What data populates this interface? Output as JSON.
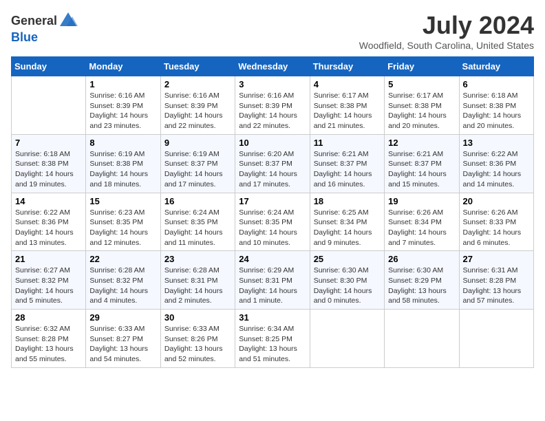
{
  "header": {
    "logo_general": "General",
    "logo_blue": "Blue",
    "month": "July 2024",
    "location": "Woodfield, South Carolina, United States"
  },
  "days_of_week": [
    "Sunday",
    "Monday",
    "Tuesday",
    "Wednesday",
    "Thursday",
    "Friday",
    "Saturday"
  ],
  "weeks": [
    [
      {
        "day": "",
        "empty": true
      },
      {
        "day": "1",
        "sunrise": "Sunrise: 6:16 AM",
        "sunset": "Sunset: 8:39 PM",
        "daylight": "Daylight: 14 hours and 23 minutes."
      },
      {
        "day": "2",
        "sunrise": "Sunrise: 6:16 AM",
        "sunset": "Sunset: 8:39 PM",
        "daylight": "Daylight: 14 hours and 22 minutes."
      },
      {
        "day": "3",
        "sunrise": "Sunrise: 6:16 AM",
        "sunset": "Sunset: 8:39 PM",
        "daylight": "Daylight: 14 hours and 22 minutes."
      },
      {
        "day": "4",
        "sunrise": "Sunrise: 6:17 AM",
        "sunset": "Sunset: 8:38 PM",
        "daylight": "Daylight: 14 hours and 21 minutes."
      },
      {
        "day": "5",
        "sunrise": "Sunrise: 6:17 AM",
        "sunset": "Sunset: 8:38 PM",
        "daylight": "Daylight: 14 hours and 20 minutes."
      },
      {
        "day": "6",
        "sunrise": "Sunrise: 6:18 AM",
        "sunset": "Sunset: 8:38 PM",
        "daylight": "Daylight: 14 hours and 20 minutes."
      }
    ],
    [
      {
        "day": "7",
        "sunrise": "Sunrise: 6:18 AM",
        "sunset": "Sunset: 8:38 PM",
        "daylight": "Daylight: 14 hours and 19 minutes."
      },
      {
        "day": "8",
        "sunrise": "Sunrise: 6:19 AM",
        "sunset": "Sunset: 8:38 PM",
        "daylight": "Daylight: 14 hours and 18 minutes."
      },
      {
        "day": "9",
        "sunrise": "Sunrise: 6:19 AM",
        "sunset": "Sunset: 8:37 PM",
        "daylight": "Daylight: 14 hours and 17 minutes."
      },
      {
        "day": "10",
        "sunrise": "Sunrise: 6:20 AM",
        "sunset": "Sunset: 8:37 PM",
        "daylight": "Daylight: 14 hours and 17 minutes."
      },
      {
        "day": "11",
        "sunrise": "Sunrise: 6:21 AM",
        "sunset": "Sunset: 8:37 PM",
        "daylight": "Daylight: 14 hours and 16 minutes."
      },
      {
        "day": "12",
        "sunrise": "Sunrise: 6:21 AM",
        "sunset": "Sunset: 8:37 PM",
        "daylight": "Daylight: 14 hours and 15 minutes."
      },
      {
        "day": "13",
        "sunrise": "Sunrise: 6:22 AM",
        "sunset": "Sunset: 8:36 PM",
        "daylight": "Daylight: 14 hours and 14 minutes."
      }
    ],
    [
      {
        "day": "14",
        "sunrise": "Sunrise: 6:22 AM",
        "sunset": "Sunset: 8:36 PM",
        "daylight": "Daylight: 14 hours and 13 minutes."
      },
      {
        "day": "15",
        "sunrise": "Sunrise: 6:23 AM",
        "sunset": "Sunset: 8:35 PM",
        "daylight": "Daylight: 14 hours and 12 minutes."
      },
      {
        "day": "16",
        "sunrise": "Sunrise: 6:24 AM",
        "sunset": "Sunset: 8:35 PM",
        "daylight": "Daylight: 14 hours and 11 minutes."
      },
      {
        "day": "17",
        "sunrise": "Sunrise: 6:24 AM",
        "sunset": "Sunset: 8:35 PM",
        "daylight": "Daylight: 14 hours and 10 minutes."
      },
      {
        "day": "18",
        "sunrise": "Sunrise: 6:25 AM",
        "sunset": "Sunset: 8:34 PM",
        "daylight": "Daylight: 14 hours and 9 minutes."
      },
      {
        "day": "19",
        "sunrise": "Sunrise: 6:26 AM",
        "sunset": "Sunset: 8:34 PM",
        "daylight": "Daylight: 14 hours and 7 minutes."
      },
      {
        "day": "20",
        "sunrise": "Sunrise: 6:26 AM",
        "sunset": "Sunset: 8:33 PM",
        "daylight": "Daylight: 14 hours and 6 minutes."
      }
    ],
    [
      {
        "day": "21",
        "sunrise": "Sunrise: 6:27 AM",
        "sunset": "Sunset: 8:32 PM",
        "daylight": "Daylight: 14 hours and 5 minutes."
      },
      {
        "day": "22",
        "sunrise": "Sunrise: 6:28 AM",
        "sunset": "Sunset: 8:32 PM",
        "daylight": "Daylight: 14 hours and 4 minutes."
      },
      {
        "day": "23",
        "sunrise": "Sunrise: 6:28 AM",
        "sunset": "Sunset: 8:31 PM",
        "daylight": "Daylight: 14 hours and 2 minutes."
      },
      {
        "day": "24",
        "sunrise": "Sunrise: 6:29 AM",
        "sunset": "Sunset: 8:31 PM",
        "daylight": "Daylight: 14 hours and 1 minute."
      },
      {
        "day": "25",
        "sunrise": "Sunrise: 6:30 AM",
        "sunset": "Sunset: 8:30 PM",
        "daylight": "Daylight: 14 hours and 0 minutes."
      },
      {
        "day": "26",
        "sunrise": "Sunrise: 6:30 AM",
        "sunset": "Sunset: 8:29 PM",
        "daylight": "Daylight: 13 hours and 58 minutes."
      },
      {
        "day": "27",
        "sunrise": "Sunrise: 6:31 AM",
        "sunset": "Sunset: 8:28 PM",
        "daylight": "Daylight: 13 hours and 57 minutes."
      }
    ],
    [
      {
        "day": "28",
        "sunrise": "Sunrise: 6:32 AM",
        "sunset": "Sunset: 8:28 PM",
        "daylight": "Daylight: 13 hours and 55 minutes."
      },
      {
        "day": "29",
        "sunrise": "Sunrise: 6:33 AM",
        "sunset": "Sunset: 8:27 PM",
        "daylight": "Daylight: 13 hours and 54 minutes."
      },
      {
        "day": "30",
        "sunrise": "Sunrise: 6:33 AM",
        "sunset": "Sunset: 8:26 PM",
        "daylight": "Daylight: 13 hours and 52 minutes."
      },
      {
        "day": "31",
        "sunrise": "Sunrise: 6:34 AM",
        "sunset": "Sunset: 8:25 PM",
        "daylight": "Daylight: 13 hours and 51 minutes."
      },
      {
        "day": "",
        "empty": true
      },
      {
        "day": "",
        "empty": true
      },
      {
        "day": "",
        "empty": true
      }
    ]
  ]
}
